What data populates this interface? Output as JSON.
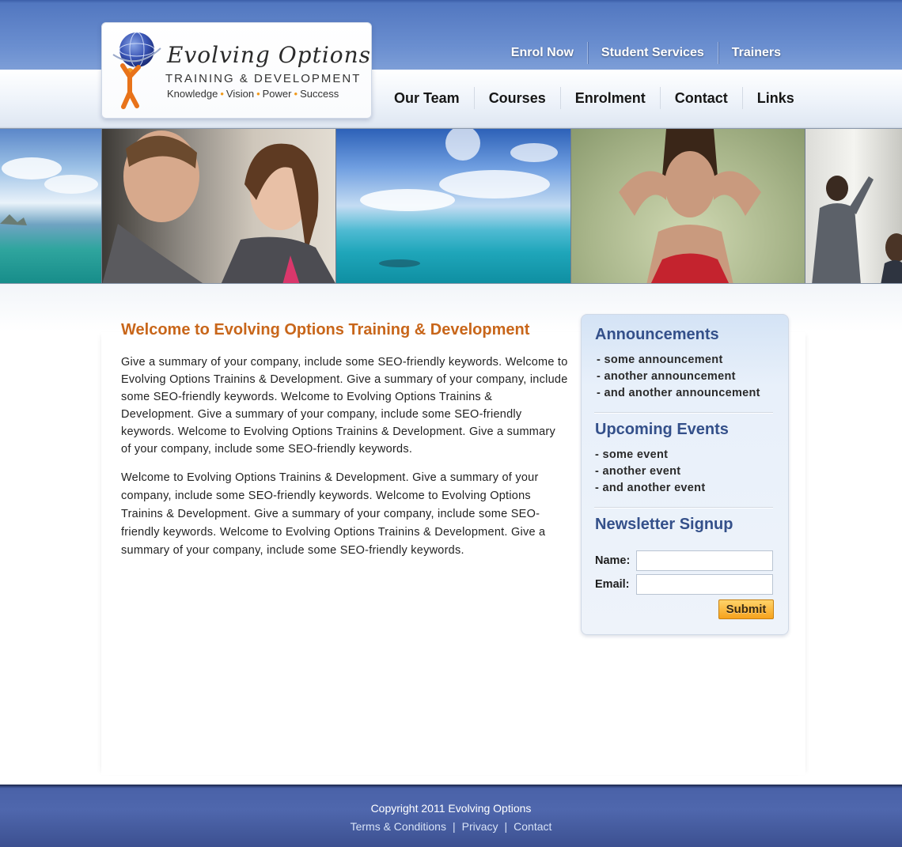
{
  "brand": {
    "name": "Evolving Options",
    "subtitle": "TRAINING & DEVELOPMENT",
    "tagline": [
      "Knowledge",
      "Vision",
      "Power",
      "Success"
    ]
  },
  "top_nav": [
    "Enrol Now",
    "Student Services",
    "Trainers"
  ],
  "main_nav": [
    "Our Team",
    "Courses",
    "Enrolment",
    "Contact",
    "Links"
  ],
  "main": {
    "title": "Welcome to Evolving Options Training & Development",
    "paragraphs": [
      "Give a summary of your company, include some SEO-friendly keywords. Welcome to Evolving Options Trainins & Development. Give a summary of your company, include some SEO-friendly keywords. Welcome to Evolving Options Trainins & Development. Give a summary of your company, include some SEO-friendly keywords. Welcome to Evolving Options Trainins & Development. Give a summary of your company, include some SEO-friendly keywords.",
      "Welcome to Evolving Options Trainins & Development. Give a summary of your company, include some SEO-friendly keywords. Welcome to Evolving Options Trainins & Development. Give a summary of your company, include some SEO-friendly keywords. Welcome to Evolving Options Trainins & Development. Give a summary of your company, include some SEO-friendly keywords."
    ]
  },
  "sidebar": {
    "announcements": {
      "title": "Announcements",
      "items": [
        "- some announcement",
        "- another announcement",
        "- and another announcement"
      ]
    },
    "events": {
      "title": "Upcoming Events",
      "items": [
        "- some event",
        "- another event",
        "- and another event"
      ]
    },
    "newsletter": {
      "title": "Newsletter Signup",
      "name_label": "Name:",
      "email_label": "Email:",
      "submit_label": "Submit"
    }
  },
  "footer": {
    "copyright": "Copyright 2011 Evolving Options",
    "links": [
      "Terms & Conditions",
      "Privacy",
      "Contact"
    ]
  },
  "colors": {
    "header_blue": "#5277c0",
    "title_orange": "#c8661a",
    "sidebar_heading": "#34508a",
    "submit_orange": "#f6a21c",
    "footer_blue": "#4f67ad"
  }
}
